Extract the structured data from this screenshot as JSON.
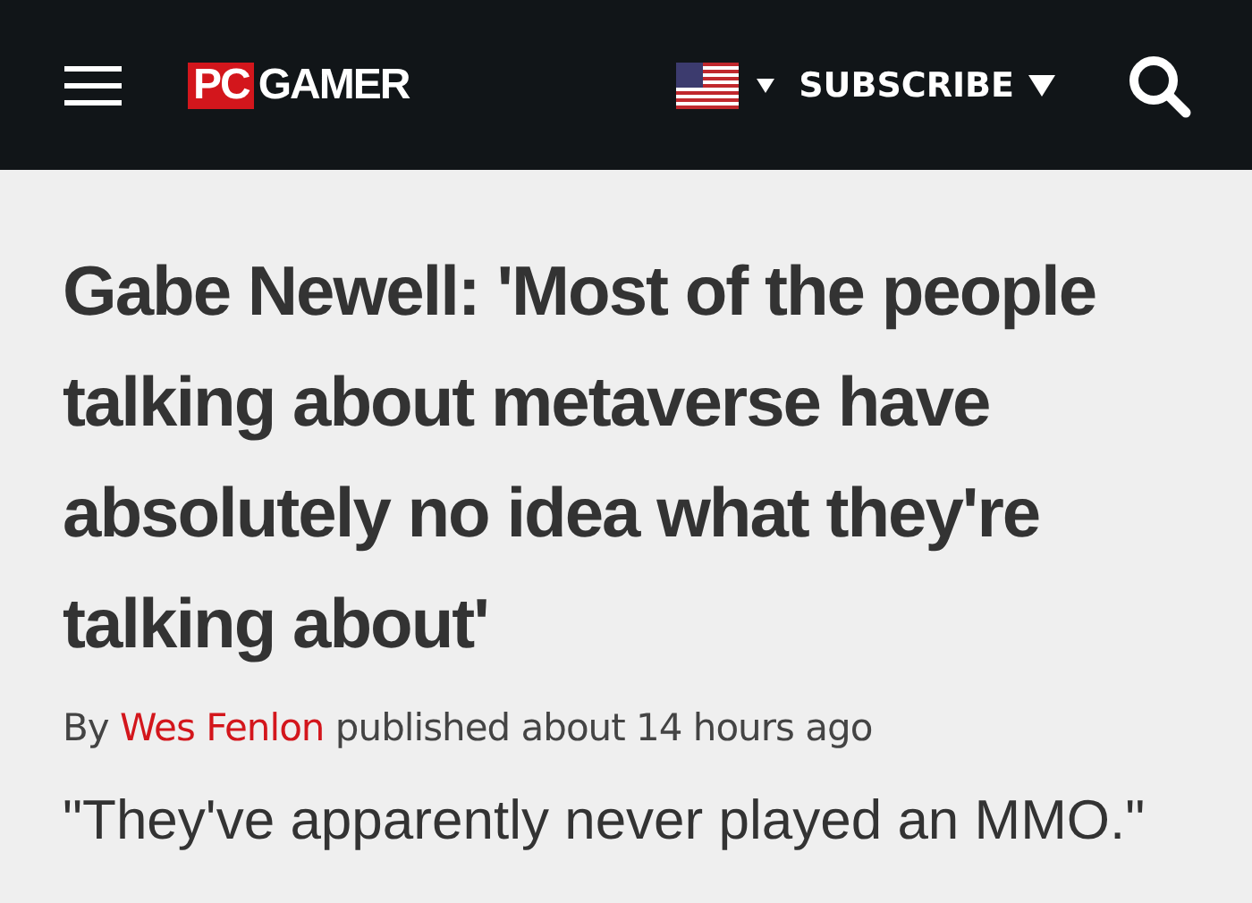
{
  "header": {
    "logo": {
      "badge": "PC",
      "word": "GAMER"
    },
    "subscribe": "SUBSCRIBE"
  },
  "article": {
    "headline": "Gabe Newell: 'Most of the people talking about metaverse have absolutely no idea what they're talking about'",
    "byline": {
      "prefix": "By",
      "author": "Wes Fenlon",
      "suffix": "published about 14 hours ago"
    },
    "standfirst": "\"They've apparently never played an MMO.\""
  }
}
